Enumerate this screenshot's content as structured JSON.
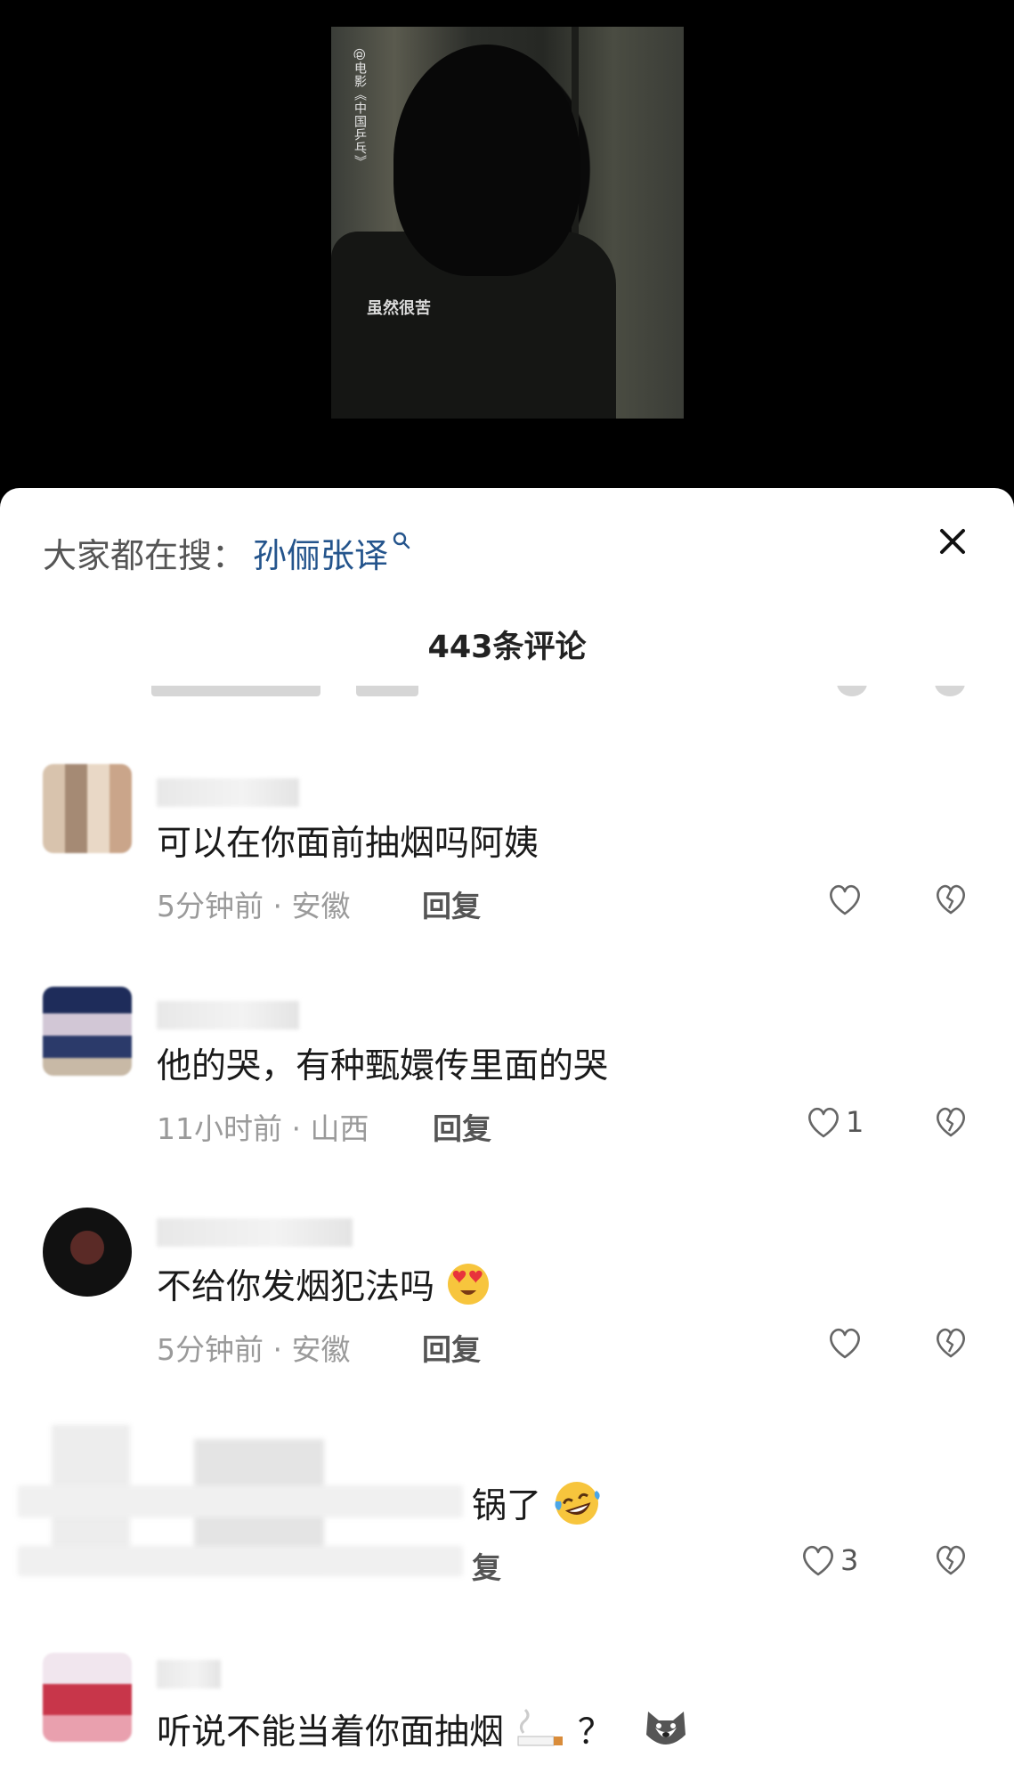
{
  "video": {
    "watermark": "@电影《中国乒乓》",
    "subtitle": "虽然很苦"
  },
  "search": {
    "prefix": "大家都在搜：",
    "term": "孙俪张译"
  },
  "comments_header": {
    "count_label": "443条评论"
  },
  "comments": [
    {
      "text": "可以在你面前抽烟吗阿姨",
      "meta": "5分钟前 · 安徽",
      "reply": "回复",
      "likes": ""
    },
    {
      "text": "他的哭，有种甄嬛传里面的哭",
      "meta": "11小时前 · 山西",
      "reply": "回复",
      "likes": "1"
    },
    {
      "text": "不给你发烟犯法吗",
      "meta": "5分钟前 · 安徽",
      "reply": "回复",
      "likes": ""
    },
    {
      "text": "锅了",
      "meta": "",
      "reply": "复",
      "likes": "3"
    },
    {
      "text": "听说不能当着你面抽烟",
      "suffix": "？",
      "meta": "",
      "reply": "",
      "likes": ""
    }
  ],
  "icons": {
    "search": "search-icon",
    "close": "close-icon",
    "like": "heart-icon",
    "dislike": "broken-heart-icon",
    "heart_eyes": "heart-eyes-emoji",
    "laugh_cry": "laugh-cry-emoji",
    "cigarette": "cigarette-emoji",
    "dog": "dog-emoji"
  },
  "colors": {
    "search_term": "#24548c",
    "meta": "#9a9a9a",
    "text": "#1a1a1a"
  }
}
